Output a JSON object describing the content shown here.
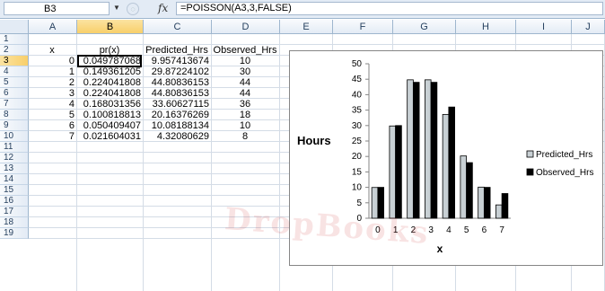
{
  "formula_bar": {
    "name_box": "B3",
    "fx_label": "fx",
    "formula": "=POISSON(A3,3,FALSE)"
  },
  "columns": [
    "A",
    "B",
    "C",
    "D",
    "E",
    "F",
    "G",
    "H",
    "I",
    "J"
  ],
  "active_column": "B",
  "rows": [
    "1",
    "2",
    "3",
    "4",
    "5",
    "6",
    "7",
    "8",
    "9",
    "10",
    "11",
    "12",
    "13",
    "14",
    "15",
    "16",
    "17",
    "18",
    "19"
  ],
  "active_row": "3",
  "table": {
    "headers": [
      "x",
      "pr(x)",
      "Predicted_Hrs",
      "Observed_Hrs"
    ],
    "rows": [
      [
        "0",
        "0.049787068",
        "9.957413674",
        "10"
      ],
      [
        "1",
        "0.149361205",
        "29.87224102",
        "30"
      ],
      [
        "2",
        "0.224041808",
        "44.80836153",
        "44"
      ],
      [
        "3",
        "0.224041808",
        "44.80836153",
        "44"
      ],
      [
        "4",
        "0.168031356",
        "33.60627115",
        "36"
      ],
      [
        "5",
        "0.100818813",
        "20.16376269",
        "18"
      ],
      [
        "6",
        "0.050409407",
        "10.08188134",
        "10"
      ],
      [
        "7",
        "0.021604031",
        "4.32080629",
        "8"
      ]
    ]
  },
  "chart_data": {
    "type": "bar",
    "categories": [
      "0",
      "1",
      "2",
      "3",
      "4",
      "5",
      "6",
      "7"
    ],
    "series": [
      {
        "name": "Predicted_Hrs",
        "values": [
          9.96,
          29.87,
          44.81,
          44.81,
          33.61,
          20.16,
          10.08,
          4.32
        ],
        "color": "#c8d0d4"
      },
      {
        "name": "Observed_Hrs",
        "values": [
          10,
          30,
          44,
          44,
          36,
          18,
          10,
          8
        ],
        "color": "#000000"
      }
    ],
    "xlabel": "x",
    "ylabel": "Hours",
    "ylim": [
      0,
      50
    ],
    "yticks": [
      "0",
      "5",
      "10",
      "15",
      "20",
      "25",
      "30",
      "35",
      "40",
      "45",
      "50"
    ],
    "legend": "right",
    "grid": false
  },
  "watermark": "DropBooks"
}
